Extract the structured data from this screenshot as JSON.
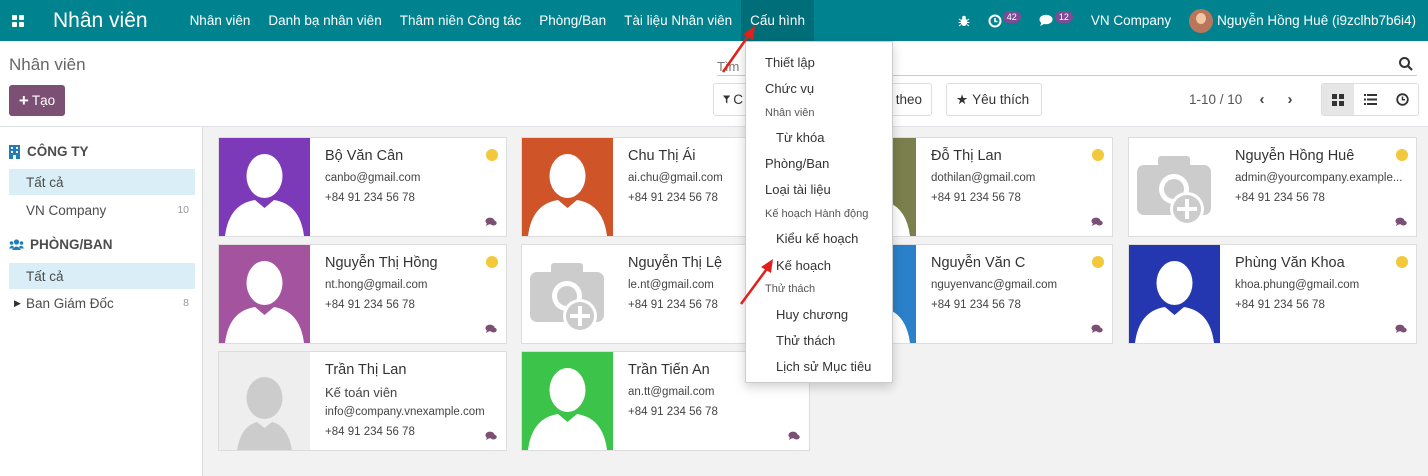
{
  "app": {
    "title": "Nhân viên",
    "menu": [
      "Nhân viên",
      "Danh bạ nhân viên",
      "Thâm niên Công tác",
      "Phòng/Ban",
      "Tài liệu Nhân viên",
      "Cấu hình"
    ],
    "active_menu": "Cấu hình",
    "badges": {
      "activities": "42",
      "messages": "12"
    },
    "company": "VN Company",
    "user": "Nguyễn Hồng Huê (i9zclhb7b6i4)",
    "accent": "#00838f"
  },
  "control": {
    "breadcrumb": "Nhân viên",
    "create_label": "Tạo",
    "search_placeholder": "Tìm",
    "filter_label": "C",
    "groupby_label": "theo",
    "favorites_label": "Yêu thích",
    "pager": "1-10 / 10"
  },
  "side": {
    "company_heading": "CÔNG TY",
    "company_items": [
      {
        "label": "Tất cả",
        "count": ""
      },
      {
        "label": "VN Company",
        "count": "10"
      }
    ],
    "dept_heading": "PHÒNG/BAN",
    "dept_items": [
      {
        "label": "Tất cả",
        "count": ""
      },
      {
        "label": "Ban Giám Đốc",
        "count": "8"
      }
    ]
  },
  "employees": [
    {
      "name": "Bộ Văn Cân",
      "job": "",
      "email": "canbo@gmail.com",
      "phone": "+84 91 234 56 78",
      "photo": "silhouette",
      "color": "#7d3ab8",
      "status": true
    },
    {
      "name": "Chu Thị Ái",
      "job": "",
      "email": "ai.chu@gmail.com",
      "phone": "+84 91 234 56 78",
      "photo": "silhouette",
      "color": "#cf5428",
      "status": false
    },
    {
      "name": "Đỗ Thị Lan",
      "job": "",
      "email": "dothilan@gmail.com",
      "phone": "+84 91 234 56 78",
      "photo": "silhouette",
      "color": "#7b7f4d",
      "status": true
    },
    {
      "name": "Nguyễn Hồng Huê",
      "job": "",
      "email": "admin@yourcompany.example...",
      "phone": "+84 91 234 56 78",
      "photo": "camera",
      "color": "#ffffff",
      "status": true
    },
    {
      "name": "Nguyễn Thị Hồng",
      "job": "",
      "email": "nt.hong@gmail.com",
      "phone": "+84 91 234 56 78",
      "photo": "silhouette",
      "color": "#a4539e",
      "status": true
    },
    {
      "name": "Nguyễn Thị Lệ",
      "job": "",
      "email": "le.nt@gmail.com",
      "phone": "+84 91 234 56 78",
      "photo": "camera",
      "color": "#ffffff",
      "status": false
    },
    {
      "name": "Nguyễn Văn C",
      "job": "",
      "email": "nguyenvanc@gmail.com",
      "phone": "+84 91 234 56 78",
      "photo": "silhouette",
      "color": "#2a81c9",
      "status": true
    },
    {
      "name": "Phùng Văn Khoa",
      "job": "",
      "email": "khoa.phung@gmail.com",
      "phone": "+84 91 234 56 78",
      "photo": "silhouette",
      "color": "#2436b0",
      "status": true
    },
    {
      "name": "Trần Thị Lan",
      "job": "Kế toán viên",
      "email": "info@company.vnexample.com",
      "phone": "+84 91 234 56 78",
      "photo": "gray",
      "color": "#eeeeee",
      "status": false
    },
    {
      "name": "Trần Tiến An",
      "job": "",
      "email": "an.tt@gmail.com",
      "phone": "+84 91 234 56 78",
      "photo": "silhouette",
      "color": "#3cc44a",
      "status": false
    }
  ],
  "dropdown": {
    "items": [
      {
        "label": "Thiết lập",
        "kind": "item"
      },
      {
        "label": "Chức vụ",
        "kind": "item"
      },
      {
        "label": "Nhân viên",
        "kind": "header"
      },
      {
        "label": "Từ khóa",
        "kind": "sub"
      },
      {
        "label": "Phòng/Ban",
        "kind": "item"
      },
      {
        "label": "Loại tài liệu",
        "kind": "item"
      },
      {
        "label": "Kế hoạch Hành động",
        "kind": "header"
      },
      {
        "label": "Kiểu kế hoạch",
        "kind": "sub"
      },
      {
        "label": "Kế hoạch",
        "kind": "sub"
      },
      {
        "label": "Thử thách",
        "kind": "header"
      },
      {
        "label": "Huy chương",
        "kind": "sub"
      },
      {
        "label": "Thử thách",
        "kind": "sub"
      },
      {
        "label": "Lịch sử Mục tiêu",
        "kind": "sub"
      }
    ]
  },
  "annotations": {
    "arrow_color": "#e0201b"
  }
}
